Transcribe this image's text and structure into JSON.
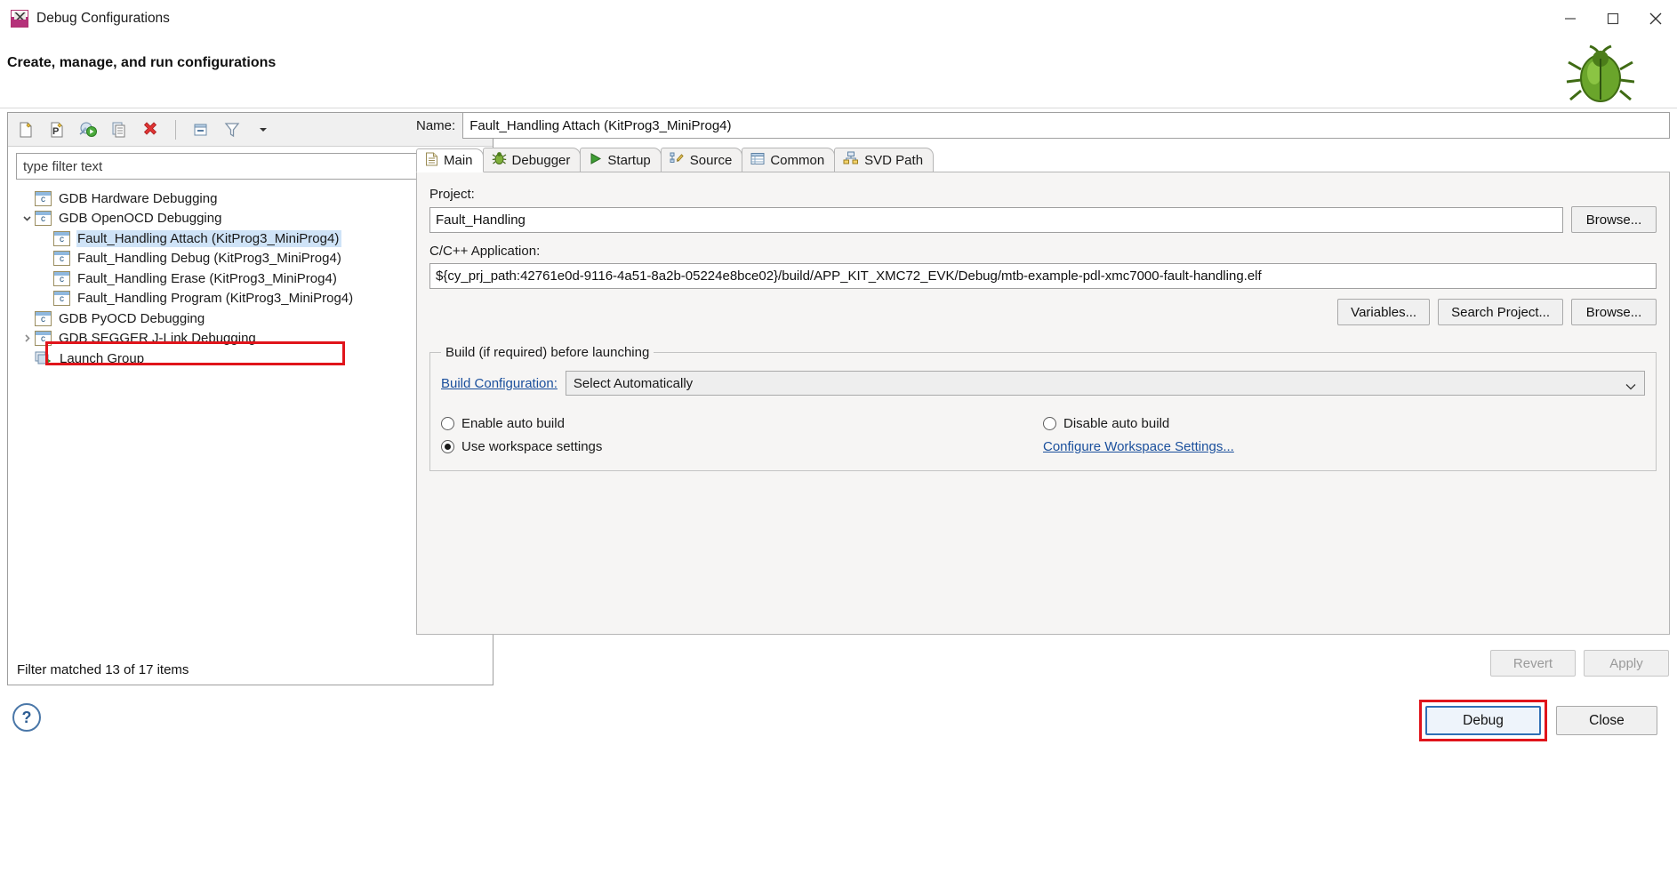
{
  "window": {
    "title": "Debug Configurations",
    "icon": "debug-configurations-icon",
    "minimize": "minimize-icon",
    "maximize": "maximize-icon",
    "close": "close-icon"
  },
  "header": {
    "title": "Create, manage, and run configurations",
    "decoration_icon": "bug-icon"
  },
  "left_panel": {
    "toolbar": [
      {
        "name": "new-launch-configuration-icon",
        "tooltip": "New launch configuration"
      },
      {
        "name": "new-launch-configuration-prototype-icon",
        "tooltip": "New prototype"
      },
      {
        "name": "export-launch-configuration-icon",
        "tooltip": "Export"
      },
      {
        "name": "duplicate-icon",
        "tooltip": "Duplicate"
      },
      {
        "name": "delete-icon",
        "tooltip": "Delete"
      },
      {
        "name": "collapse-all-icon",
        "tooltip": "Collapse All"
      },
      {
        "name": "filter-icon",
        "tooltip": "Filter launch configurations"
      },
      {
        "name": "view-menu-icon",
        "tooltip": "View Menu"
      }
    ],
    "filter": {
      "placeholder": "type filter text",
      "value": ""
    },
    "tree": [
      {
        "label": "GDB Hardware Debugging",
        "level": 0,
        "icon": "c-config-icon",
        "twisty": "none",
        "selected": false
      },
      {
        "label": "GDB OpenOCD Debugging",
        "level": 0,
        "icon": "c-config-icon",
        "twisty": "expanded",
        "selected": false
      },
      {
        "label": "Fault_Handling Attach (KitProg3_MiniProg4)",
        "level": 1,
        "icon": "c-config-icon",
        "twisty": "none",
        "selected": true
      },
      {
        "label": "Fault_Handling Debug (KitProg3_MiniProg4)",
        "level": 1,
        "icon": "c-config-icon",
        "twisty": "none",
        "selected": false
      },
      {
        "label": "Fault_Handling Erase (KitProg3_MiniProg4)",
        "level": 1,
        "icon": "c-config-icon",
        "twisty": "none",
        "selected": false
      },
      {
        "label": "Fault_Handling Program (KitProg3_MiniProg4)",
        "level": 1,
        "icon": "c-config-icon",
        "twisty": "none",
        "selected": false
      },
      {
        "label": "GDB PyOCD Debugging",
        "level": 0,
        "icon": "c-config-icon",
        "twisty": "none",
        "selected": false
      },
      {
        "label": "GDB SEGGER J-Link Debugging",
        "level": 0,
        "icon": "c-config-icon",
        "twisty": "collapsed",
        "selected": false
      },
      {
        "label": "Launch Group",
        "level": 0,
        "icon": "launch-group-icon",
        "twisty": "none",
        "selected": false
      }
    ],
    "status": "Filter matched 13 of 17 items"
  },
  "right_panel": {
    "name_label": "Name:",
    "name_value": "Fault_Handling Attach (KitProg3_MiniProg4)",
    "tabs": [
      {
        "label": "Main",
        "icon": "document-icon",
        "active": true
      },
      {
        "label": "Debugger",
        "icon": "bug-icon",
        "active": false
      },
      {
        "label": "Startup",
        "icon": "play-icon",
        "active": false
      },
      {
        "label": "Source",
        "icon": "source-edit-icon",
        "active": false
      },
      {
        "label": "Common",
        "icon": "table-icon",
        "active": false
      },
      {
        "label": "SVD Path",
        "icon": "hierarchy-icon",
        "active": false
      }
    ],
    "main": {
      "project_label": "Project:",
      "project_value": "Fault_Handling",
      "project_browse": "Browse...",
      "application_label": "C/C++ Application:",
      "application_value": "${cy_prj_path:42761e0d-9116-4a51-8a2b-05224e8bce02}/build/APP_KIT_XMC72_EVK/Debug/mtb-example-pdl-xmc7000-fault-handling.elf",
      "app_buttons": [
        "Variables...",
        "Search Project...",
        "Browse..."
      ],
      "build_group_label": "Build (if required) before launching",
      "build_configuration_link": "Build Configuration:",
      "build_configuration_value": "Select Automatically",
      "radios": [
        {
          "label": "Enable auto build",
          "selected": false
        },
        {
          "label": "Disable auto build",
          "selected": false
        },
        {
          "label": "Use workspace settings",
          "selected": true
        }
      ],
      "configure_workspace_link": "Configure Workspace Settings..."
    },
    "revert_label": "Revert",
    "apply_label": "Apply",
    "revert_enabled": false,
    "apply_enabled": false
  },
  "footer": {
    "help_icon": "help-icon",
    "debug_label": "Debug",
    "close_label": "Close"
  },
  "colors": {
    "selection_blue": "#cfe3f7",
    "highlight_red": "#e0141b",
    "link_blue": "#1a4f9c",
    "default_button_border": "#2f6fb5"
  }
}
